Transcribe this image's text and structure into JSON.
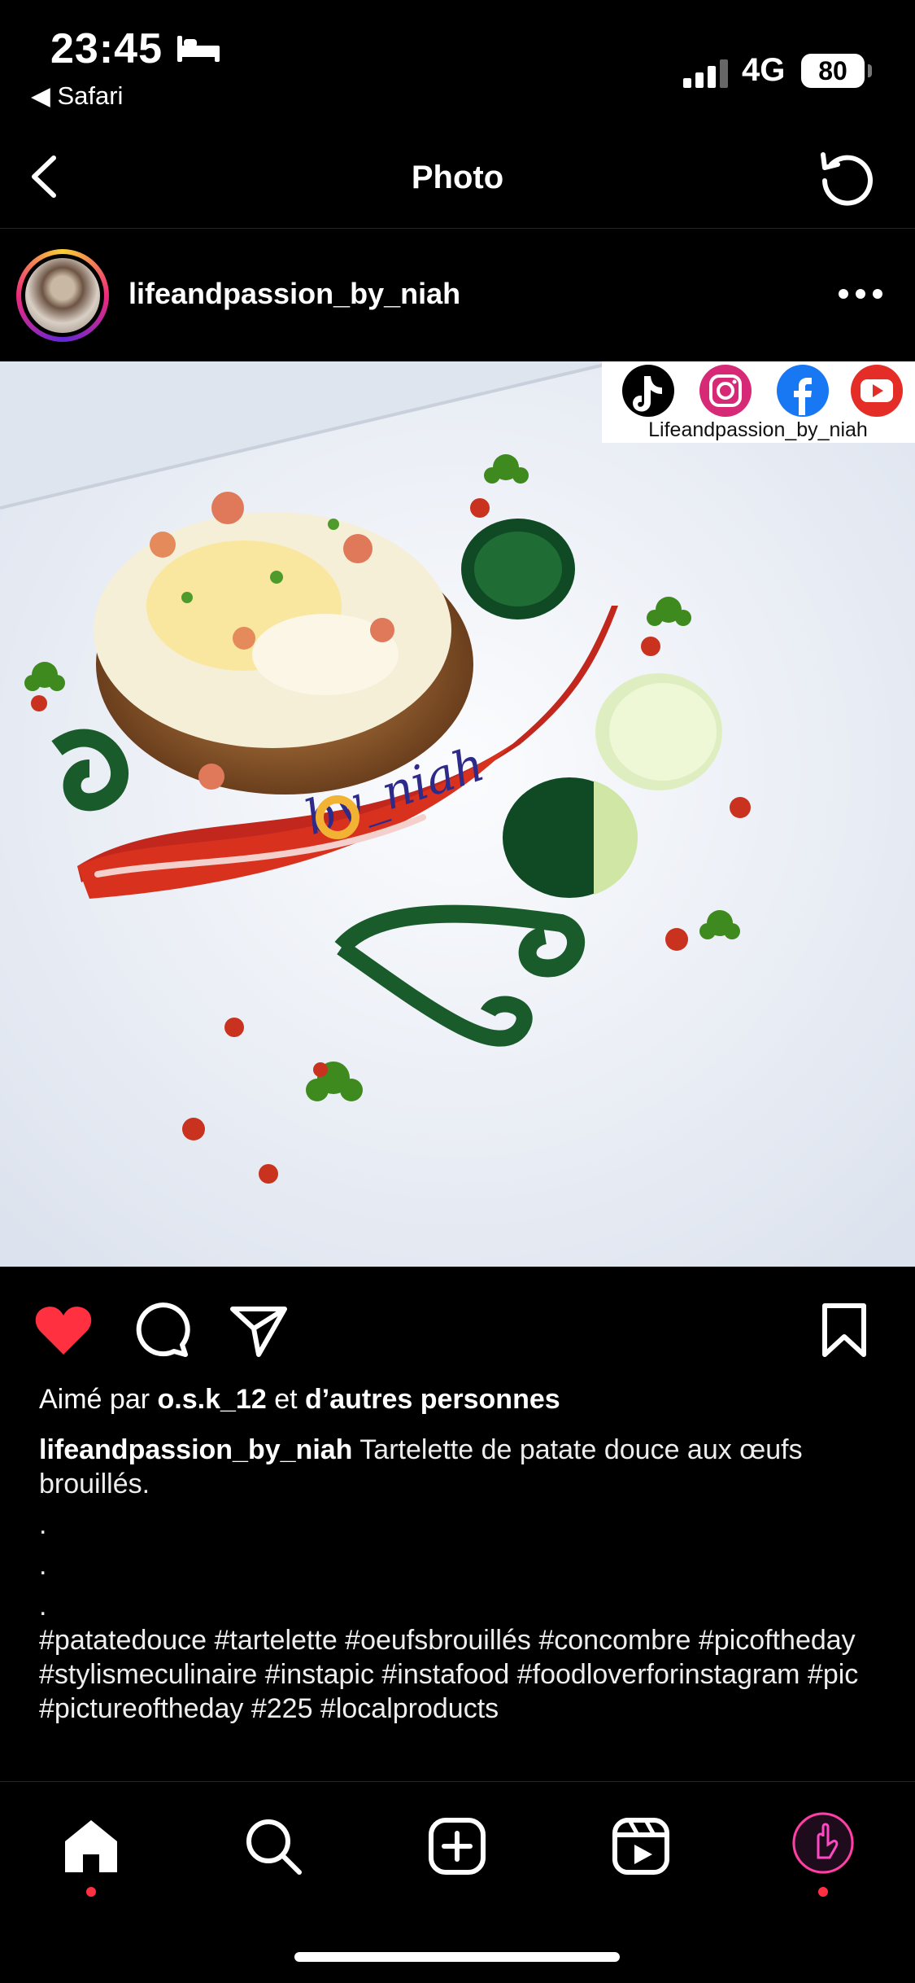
{
  "status_bar": {
    "time": "23:45",
    "back_app": "◀ Safari",
    "network": "4G",
    "battery": "80"
  },
  "nav": {
    "title": "Photo"
  },
  "post": {
    "username": "lifeandpassion_by_niah",
    "photo": {
      "watermark_handle": "Lifeandpassion_by_niah",
      "signature": "by_niah",
      "social_icons": [
        "tiktok-icon",
        "instagram-icon",
        "facebook-icon",
        "youtube-icon"
      ]
    },
    "liked": true,
    "likes": {
      "prefix": "Aimé par",
      "user": "o.s.k_12",
      "connector": "et",
      "others": "d’autres personnes"
    },
    "caption": {
      "user": "lifeandpassion_by_niah",
      "text": "Tartelette de patate douce aux œufs brouillés.",
      "dots": [
        ".",
        ".",
        "."
      ],
      "hashtags": "#patatedouce #tartelette #oeufsbrouillés #concombre #picoftheday #stylismeculinaire #instapic #instafood #foodloverforinstagram #pic #pictureoftheday #225 #localproducts"
    }
  },
  "colors": {
    "like_red": "#ff3040",
    "background": "#000000"
  }
}
